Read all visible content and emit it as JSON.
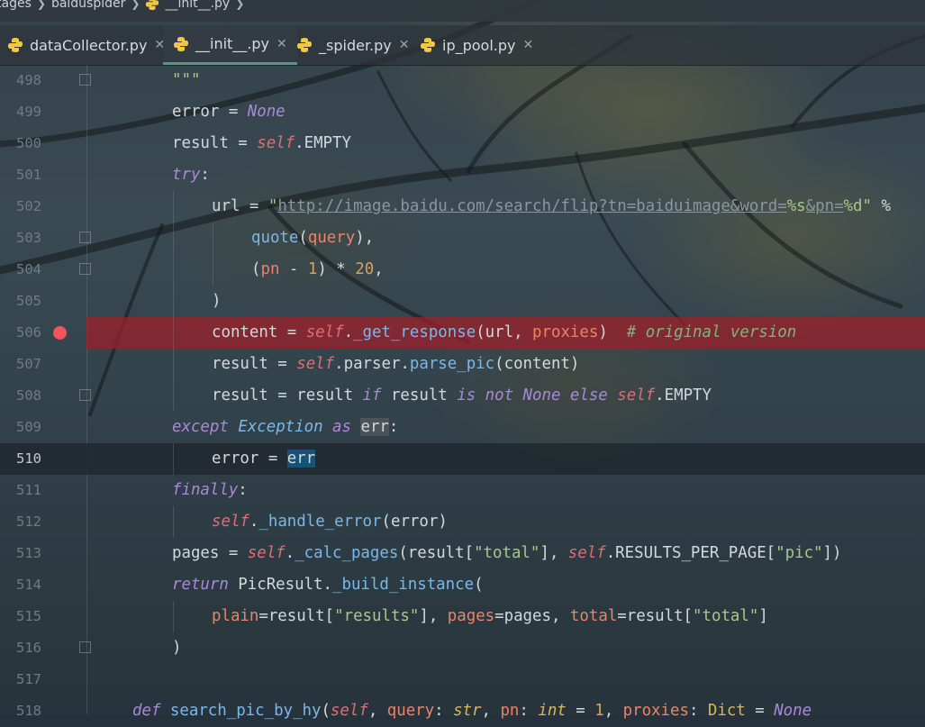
{
  "breadcrumb": {
    "items": [
      "tages",
      "baiduspider",
      "__init__.py"
    ]
  },
  "tabs": [
    {
      "label": "dataCollector.py",
      "active": false
    },
    {
      "label": "__init__.py",
      "active": true
    },
    {
      "label": "_spider.py",
      "active": false
    },
    {
      "label": "ip_pool.py",
      "active": false
    }
  ],
  "code": {
    "current_line": 510,
    "breakpoint_line": 506,
    "lines": [
      {
        "n": "498",
        "text": "\"\"\""
      },
      {
        "n": "499",
        "text": "error = None"
      },
      {
        "n": "500",
        "text": "result = self.EMPTY"
      },
      {
        "n": "501",
        "text": "try:"
      },
      {
        "n": "502",
        "text": "url = \"http://image.baidu.com/search/flip?tn=baiduimage&word=%s&pn=%d\" %"
      },
      {
        "n": "503",
        "text": "quote(query),"
      },
      {
        "n": "504",
        "text": "(pn - 1) * 20,"
      },
      {
        "n": "505",
        "text": ")"
      },
      {
        "n": "506",
        "text": "content = self._get_response(url, proxies)  # original version"
      },
      {
        "n": "507",
        "text": "result = self.parser.parse_pic(content)"
      },
      {
        "n": "508",
        "text": "result = result if result is not None else self.EMPTY"
      },
      {
        "n": "509",
        "text": "except Exception as err:"
      },
      {
        "n": "510",
        "text": "error = err"
      },
      {
        "n": "511",
        "text": "finally:"
      },
      {
        "n": "512",
        "text": "self._handle_error(error)"
      },
      {
        "n": "513",
        "text": "pages = self._calc_pages(result[\"total\"], self.RESULTS_PER_PAGE[\"pic\"])"
      },
      {
        "n": "514",
        "text": "return PicResult._build_instance("
      },
      {
        "n": "515",
        "text": "plain=result[\"results\"], pages=pages, total=result[\"total\"]"
      },
      {
        "n": "516",
        "text": ")"
      },
      {
        "n": "517",
        "text": ""
      },
      {
        "n": "518",
        "text": "def search_pic_by_hy(self, query: str, pn: int = 1, proxies: Dict = None"
      }
    ]
  },
  "colors": {
    "keyword": "#a989d6",
    "self": "#e06c75",
    "string": "#a8c88a",
    "number": "#d9a060",
    "function": "#7ab8ea",
    "comment": "#7fb47f",
    "breakpoint": "#f0545c",
    "tab_underline": "#4a9a88"
  }
}
